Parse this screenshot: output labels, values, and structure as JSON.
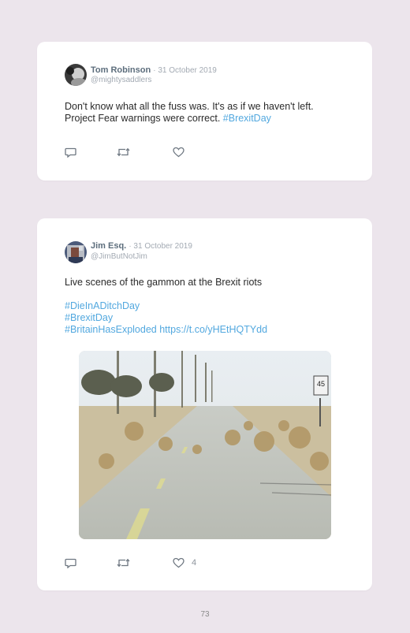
{
  "tweets": [
    {
      "author_name": "Tom Robinson",
      "date": "31 October 2019",
      "handle": "@mightysaddlers",
      "text_line1": "Don't know what all the fuss was. It's as if we haven't left.",
      "text_line2": "Project Fear warnings were correct.",
      "hashtag": "#BrexitDay",
      "like_count": ""
    },
    {
      "author_name": "Jim Esq.",
      "date": "31 October 2019",
      "handle": "@JimButNotJim",
      "text": "Live scenes of the gammon at the Brexit riots",
      "hashtags": [
        "#DieInADitchDay",
        "#BrexitDay"
      ],
      "last_line_tag": "#BritainHasExploded",
      "link": "https://t.co/yHEtHQTYdd",
      "like_count": "4",
      "media_sign_text": "45"
    }
  ],
  "page_number": "73",
  "colors": {
    "page_background": "#ece5ec",
    "card": "#ffffff",
    "hashtag": "#52a8df",
    "muted": "#a3aab3",
    "name": "#5c6d7c"
  },
  "icons": [
    "reply-icon",
    "retweet-icon",
    "like-icon"
  ]
}
